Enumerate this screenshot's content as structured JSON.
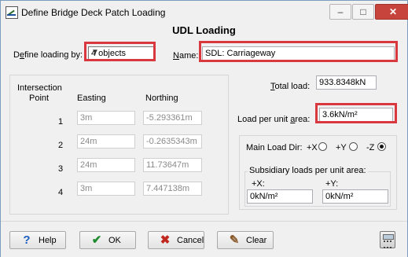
{
  "window": {
    "title": "Define Bridge Deck Patch Loading",
    "minimize": "–",
    "maximize": "□",
    "close": "✕"
  },
  "heading": "UDL Loading",
  "define_loading": {
    "label_pre": "D",
    "label_u": "e",
    "label_post": "fine loading by:",
    "value": "4 objects"
  },
  "name": {
    "label_u": "N",
    "label_post": "ame:",
    "value": "SDL: Carriageway"
  },
  "table": {
    "header_intersection_1": "Intersection",
    "header_intersection_2": "Point",
    "header_easting": "Easting",
    "header_northing": "Northing",
    "rows": [
      {
        "point": "1",
        "easting": "3m",
        "northing": "-5.293361m"
      },
      {
        "point": "2",
        "easting": "24m",
        "northing": "-0.2635343m"
      },
      {
        "point": "3",
        "easting": "24m",
        "northing": "11.73647m"
      },
      {
        "point": "4",
        "easting": "3m",
        "northing": "7.447138m"
      }
    ]
  },
  "total_load": {
    "label_u": "T",
    "label_post": "otal load:",
    "value": "933.8348kN"
  },
  "load_per_unit_area": {
    "label_pre": "Load per unit ",
    "label_u": "a",
    "label_post": "rea:",
    "value": "3.6kN/m²"
  },
  "main_load_dir": {
    "label": "Main Load Dir:",
    "options": [
      "+X",
      "+Y",
      "-Z"
    ],
    "selected": "-Z"
  },
  "subsidiary": {
    "label": "Subsidiary loads per unit area:",
    "x_label": "+X:",
    "x_value": "0kN/m²",
    "y_label": "+Y:",
    "y_value": "0kN/m²"
  },
  "buttons": {
    "help": "Help",
    "ok": "OK",
    "cancel": "Cancel",
    "clear": "Clear"
  },
  "colors": {
    "highlight": "#d9383e",
    "ok_check": "#1f8a2e",
    "cancel_x": "#c0281f",
    "help_icon": "#1d5fbf"
  }
}
